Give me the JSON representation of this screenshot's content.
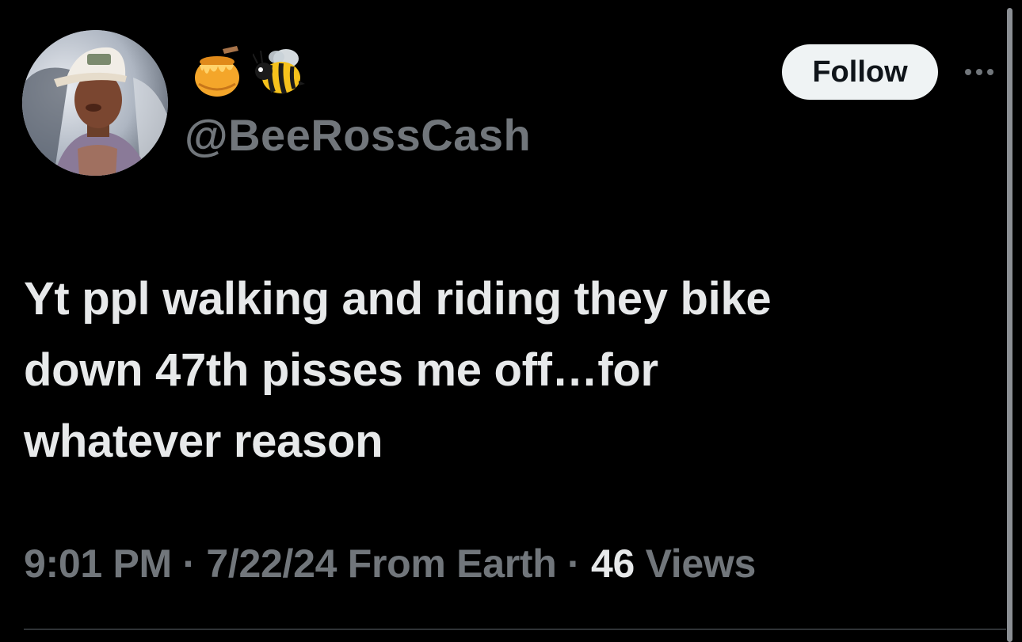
{
  "profile": {
    "avatar_icon": "profile-photo",
    "display_name_emojis": [
      "honey-pot-icon",
      "bee-icon"
    ],
    "handle": "@BeeRossCash"
  },
  "actions": {
    "follow_label": "Follow",
    "more_icon": "more-options-icon"
  },
  "tweet": {
    "lines": [
      "Yt ppl walking and riding they bike",
      "down 47th pisses me off…for",
      "whatever reason"
    ]
  },
  "meta": {
    "time": "9:01 PM",
    "separator": "·",
    "date": "7/22/24",
    "location": "From Earth",
    "views_count": "46",
    "views_label": "Views"
  },
  "colors": {
    "background": "#000000",
    "text_primary": "#e7e9ea",
    "text_secondary": "#71767b",
    "follow_bg": "#eff3f4"
  }
}
